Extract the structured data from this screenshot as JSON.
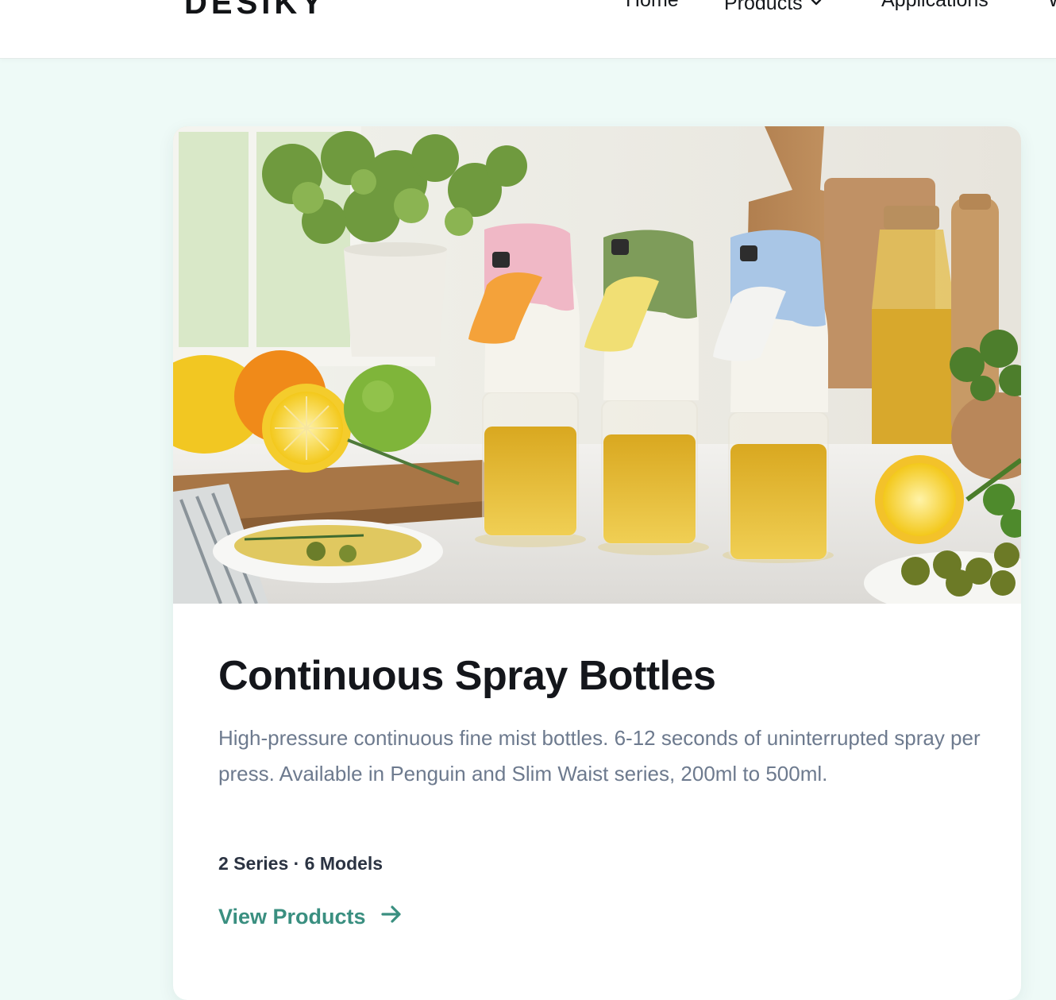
{
  "header": {
    "logo": "DESIKY",
    "nav": {
      "home": "Home",
      "products": "Products",
      "applications": "Applications",
      "more": "W"
    }
  },
  "card": {
    "title": "Continuous Spray Bottles",
    "description": "High-pressure continuous fine mist bottles. 6-12 seconds of uninterrupted spray per press. Available in Penguin and Slim Waist series, 200ml to 500ml.",
    "meta": "2 Series · 6 Models",
    "link_label": "View Products"
  },
  "colors": {
    "page_bg": "#eefaf7",
    "link": "#3a8f80",
    "title": "#14161b",
    "body_text": "#6d7a8e"
  },
  "icons": {
    "products_dropdown": "chevron-down-icon",
    "link_arrow": "arrow-right-icon"
  }
}
